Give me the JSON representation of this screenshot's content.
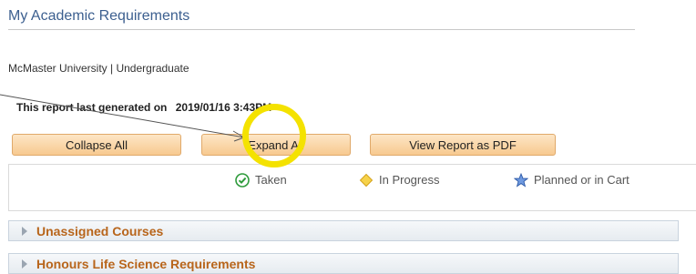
{
  "page": {
    "title": "My Academic Requirements"
  },
  "org": {
    "text": "McMaster University | Undergraduate"
  },
  "generated": {
    "label": "This report last generated on",
    "datetime": "2019/01/16  3:43PM"
  },
  "buttons": {
    "collapse": "Collapse All",
    "expand": "Expand All",
    "pdf": "View Report as PDF"
  },
  "legend": {
    "taken": {
      "label": "Taken",
      "icon": "check-circle-icon",
      "color": "#2e9b3b"
    },
    "in_progress": {
      "label": "In Progress",
      "icon": "diamond-icon",
      "color": "#f2c23a"
    },
    "planned": {
      "label": "Planned or in Cart",
      "icon": "star-icon",
      "color": "#4a78c4"
    }
  },
  "sections": [
    {
      "label": "Unassigned Courses"
    },
    {
      "label": "Honours Life Science Requirements"
    }
  ]
}
